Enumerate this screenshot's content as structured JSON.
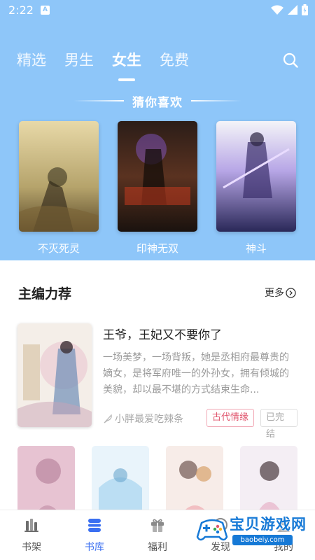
{
  "status_bar": {
    "time": "2:22",
    "notification_letter": "A"
  },
  "top_tabs": [
    {
      "label": "精选",
      "active": false
    },
    {
      "label": "男生",
      "active": false
    },
    {
      "label": "女生",
      "active": true
    },
    {
      "label": "免费",
      "active": false
    }
  ],
  "guess": {
    "title": "猜你喜欢",
    "books": [
      {
        "title": "不灭死灵"
      },
      {
        "title": "印神无双"
      },
      {
        "title": "神斗"
      }
    ]
  },
  "editor_picks": {
    "title": "主编力荐",
    "more_label": "更多",
    "feature": {
      "title": "王爷，王妃又不要你了",
      "description": "一场美梦，一场背叛，她是丞相府最尊贵的嫡女，是将军府唯一的外孙女，拥有倾城的美貌，却以最不堪的方式结束生命...",
      "author": "小胖最爱吃辣条",
      "genre_tag": "古代情缘",
      "status_tag": "已完结"
    }
  },
  "bottom_nav": [
    {
      "label": "书架",
      "icon": "bookshelf-icon",
      "active": false
    },
    {
      "label": "书库",
      "icon": "library-icon",
      "active": true
    },
    {
      "label": "福利",
      "icon": "gift-icon",
      "active": false
    },
    {
      "label": "发现",
      "icon": "discover-icon",
      "active": false
    },
    {
      "label": "我的",
      "icon": "profile-icon",
      "active": false
    }
  ],
  "watermark": {
    "text": "宝贝游戏网",
    "url": "baobeiy.com"
  },
  "colors": {
    "hero": "#8ec6f9",
    "accent": "#3a6ff1",
    "genre_tag": "#e0566e"
  }
}
